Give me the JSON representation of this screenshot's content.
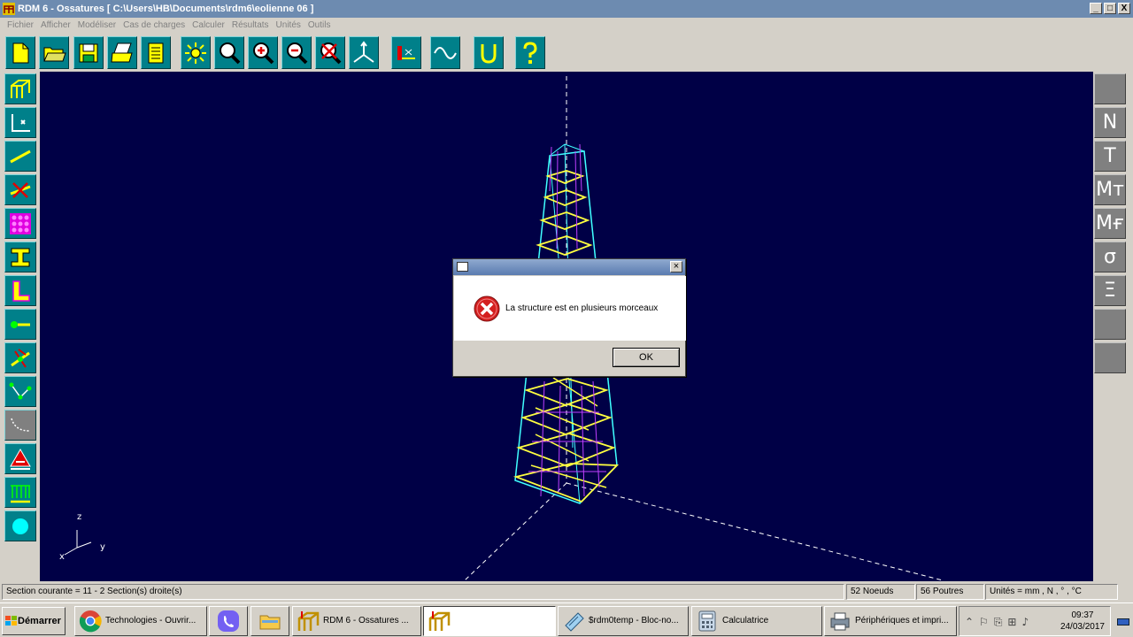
{
  "window": {
    "title": "RDM 6 - Ossatures   [ C:\\Users\\HB\\Documents\\rdm6\\eolienne 06 ]",
    "minimize": "_",
    "maximize": "□",
    "close": "X"
  },
  "menu": [
    "Fichier",
    "Afficher",
    "Modéliser",
    "Cas de charges",
    "Calculer",
    "Résultats",
    "Unités",
    "Outils"
  ],
  "toolbar": {
    "buttons": [
      "new-file",
      "open-folder",
      "save",
      "print",
      "document",
      "light",
      "zoom",
      "zoom-in",
      "zoom-out",
      "zoom-cancel",
      "axes",
      "section",
      "wave",
      "magnet",
      "help"
    ]
  },
  "right_toolbar": {
    "labels": [
      "",
      "N",
      "T",
      "Mт",
      "Mғ",
      "σ",
      "Ξ",
      "",
      ""
    ]
  },
  "axes": {
    "z": "z",
    "x": "x",
    "y": "y"
  },
  "dialog": {
    "message": "La structure est en plusieurs morceaux",
    "ok_label": "OK",
    "close": "×"
  },
  "statusbar": {
    "section": "Section courante = 11 -  2  Section(s) droite(s)",
    "nodes": "52 Noeuds",
    "beams": "56 Poutres",
    "units": "Unités = mm , N , ° , °C"
  },
  "taskbar": {
    "start": "Démarrer",
    "tasks": [
      {
        "label": "Technologies - Ouvrir...",
        "icon": "chrome-icon"
      },
      {
        "label": "",
        "icon": "viber-icon"
      },
      {
        "label": "",
        "icon": "folder-icon"
      },
      {
        "label": "RDM 6 - Ossatures    ...",
        "icon": "rdm-icon"
      },
      {
        "label": "",
        "icon": "rdm-icon"
      },
      {
        "label": "$rdm0temp - Bloc-no...",
        "icon": "notepad-icon"
      },
      {
        "label": "Calculatrice",
        "icon": "calculator-icon"
      },
      {
        "label": "Périphériques et impri...",
        "icon": "printer-icon"
      }
    ],
    "clock_time": "09:37",
    "clock_date": "24/03/2017"
  },
  "colors": {
    "canvas_bg": "#000046",
    "button_teal": "#00808a",
    "structure_cyan": "#40ffff",
    "structure_yellow": "#ffff40",
    "structure_magenta": "#c040ff"
  }
}
